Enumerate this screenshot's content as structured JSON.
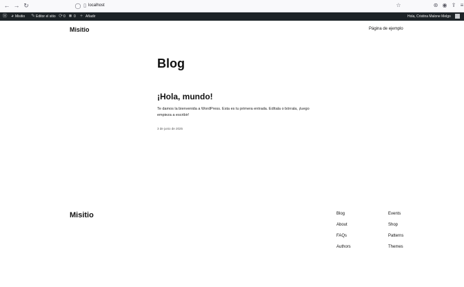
{
  "browser": {
    "url": "localhost",
    "back_icon": "back-arrow-icon",
    "forward_icon": "forward-arrow-icon",
    "reload_icon": "reload-icon"
  },
  "admin_bar": {
    "site_name": "Misitio",
    "editor_label": "Editor el sitio",
    "updates_count": "0",
    "comments_count": "0",
    "new_label": "Añadir",
    "greeting": "Hola, Cristina Malone Melgo"
  },
  "header": {
    "site_title": "Misitio",
    "nav_link": "Página de ejemplo"
  },
  "main": {
    "heading": "Blog",
    "post": {
      "title": "¡Hola, mundo!",
      "excerpt": "Te damos la bienvenida a WordPress. Esta es tu primera entrada. Edítala o bórrala, ¡luego empieza a escribir!",
      "date": "3 de junio de 2025"
    }
  },
  "footer": {
    "site_title": "Misitio",
    "col1": [
      "Blog",
      "About",
      "FAQs",
      "Authors"
    ],
    "col2": [
      "Events",
      "Shop",
      "Patterns",
      "Themes"
    ],
    "bottom_left": "",
    "bottom_right": ""
  }
}
